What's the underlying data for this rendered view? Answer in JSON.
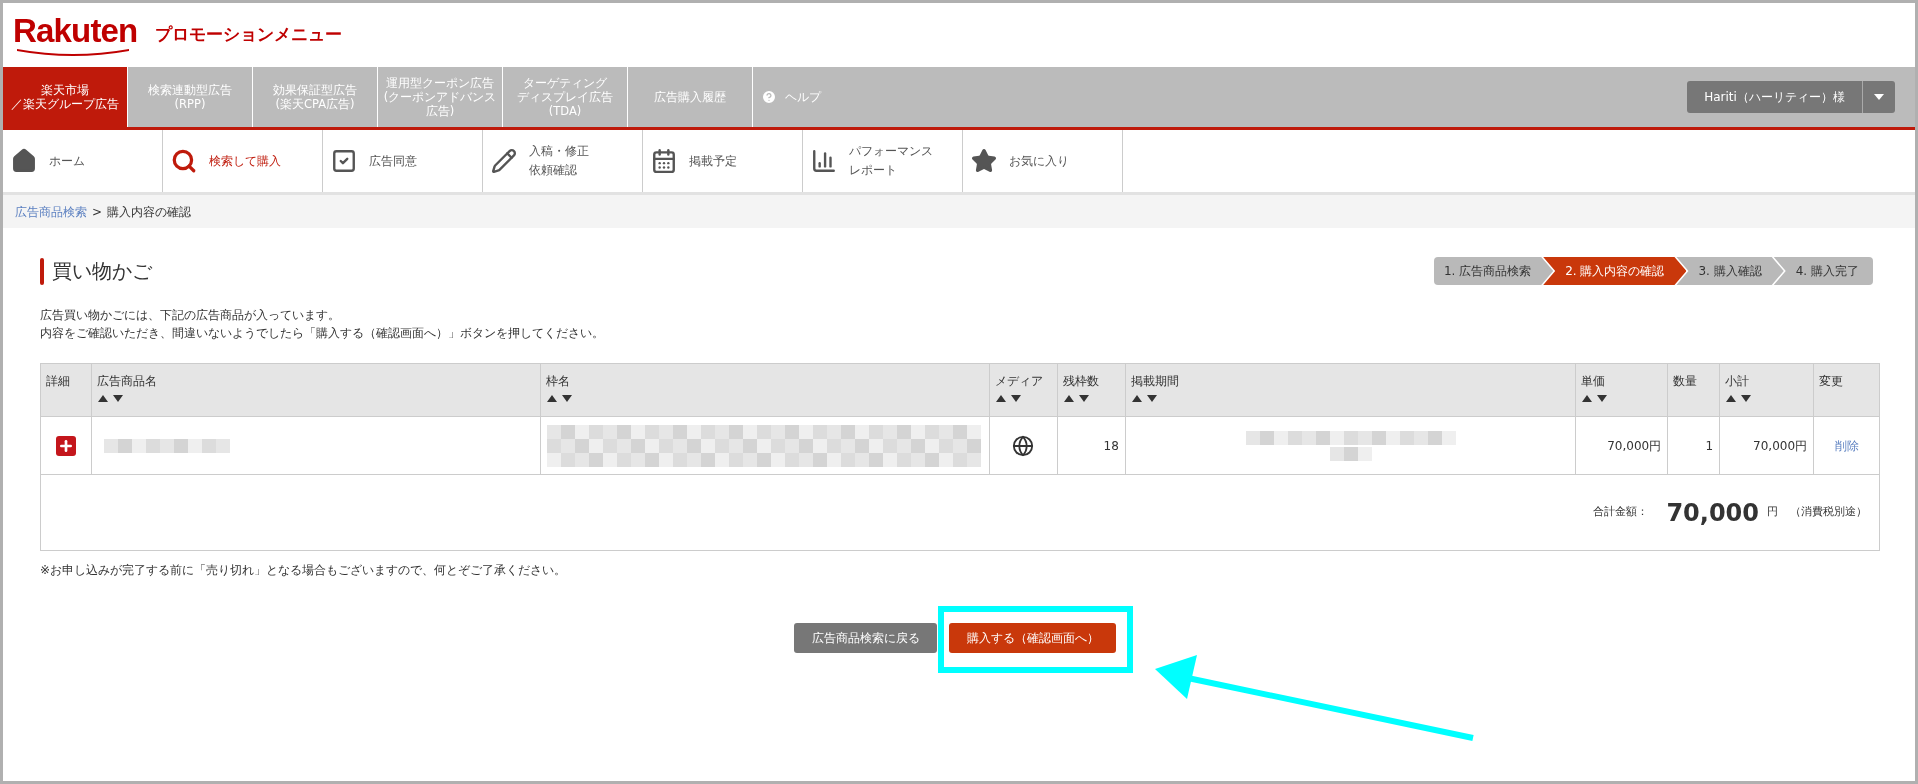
{
  "header": {
    "logo": "Rakuten",
    "title": "プロモーションメニュー"
  },
  "top_tabs": [
    {
      "lines": [
        "楽天市場",
        "／楽天グループ広告"
      ],
      "selected": true
    },
    {
      "lines": [
        "検索連動型広告",
        "(RPP)"
      ],
      "selected": false
    },
    {
      "lines": [
        "効果保証型広告",
        "(楽天CPA広告)"
      ],
      "selected": false
    },
    {
      "lines": [
        "運用型クーポン広告",
        "(クーポンアドバンス",
        "広告)"
      ],
      "selected": false
    },
    {
      "lines": [
        "ターゲティング",
        "ディスプレイ広告",
        "(TDA)"
      ],
      "selected": false
    },
    {
      "lines": [
        "広告購入履歴"
      ],
      "selected": false
    }
  ],
  "help": "ヘルプ",
  "user_menu": "Hariti（ハーリティー）様",
  "sub_nav": [
    {
      "lines": [
        "ホーム"
      ],
      "selected": false
    },
    {
      "lines": [
        "検索して購入"
      ],
      "selected": true
    },
    {
      "lines": [
        "広告同意"
      ],
      "selected": false
    },
    {
      "lines": [
        "入稿・修正",
        "依頼確認"
      ],
      "selected": false
    },
    {
      "lines": [
        "掲載予定"
      ],
      "selected": false
    },
    {
      "lines": [
        "パフォーマンス",
        "レポート"
      ],
      "selected": false
    },
    {
      "lines": [
        "お気に入り"
      ],
      "selected": false
    }
  ],
  "breadcrumb": {
    "link": "広告商品検索",
    "separator": ">",
    "current": "購入内容の確認"
  },
  "page_title": "買い物かご",
  "steps": [
    {
      "label": "1. 広告商品検索",
      "selected": false
    },
    {
      "label": "2. 購入内容の確認",
      "selected": true
    },
    {
      "label": "3. 購入確認",
      "selected": false
    },
    {
      "label": "4. 購入完了",
      "selected": false
    }
  ],
  "intro": [
    "広告買い物かごには、下記の広告商品が入っています。",
    "内容をご確認いただき、間違いないようでしたら「購入する（確認画面へ）」ボタンを押してください。"
  ],
  "table": {
    "columns": [
      {
        "label": "詳細",
        "sortable": false
      },
      {
        "label": "広告商品名",
        "sortable": true
      },
      {
        "label": "枠名",
        "sortable": true
      },
      {
        "label": "メディア",
        "sortable": true
      },
      {
        "label": "残枠数",
        "sortable": true
      },
      {
        "label": "掲載期間",
        "sortable": true
      },
      {
        "label": "単価",
        "sortable": true
      },
      {
        "label": "数量",
        "sortable": false
      },
      {
        "label": "小計",
        "sortable": true
      },
      {
        "label": "変更",
        "sortable": false
      }
    ],
    "rows": [
      {
        "remaining": "18",
        "unit_price": "70,000円",
        "quantity": "1",
        "subtotal": "70,000円",
        "action": "削除"
      }
    ],
    "total": {
      "label": "合計金額：",
      "amount": "70,000",
      "unit": "円",
      "note": "（消費税別途）"
    }
  },
  "notice": "※お申し込みが完了する前に「売り切れ」となる場合もございますので、何とぞご了承ください。",
  "buttons": [
    {
      "label": "広告商品検索に戻る",
      "kind": "secondary"
    },
    {
      "label": "購入する（確認画面へ）",
      "kind": "primary"
    }
  ]
}
